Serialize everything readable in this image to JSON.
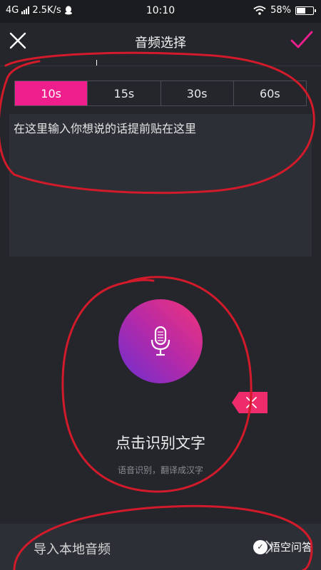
{
  "status_bar": {
    "network": "4G",
    "speed": "2.5K/s",
    "time": "10:10",
    "battery": "58%",
    "battery_level": 0.58,
    "icons": [
      "signal-icon",
      "qq-icon",
      "wifi-icon",
      "battery-icon"
    ]
  },
  "header": {
    "title": "音频选择",
    "close_icon": "close-icon",
    "confirm_icon": "checkmark-icon",
    "accent_color": "#ee1e8d"
  },
  "duration_tabs": [
    {
      "label": "10s",
      "selected": true
    },
    {
      "label": "15s",
      "selected": false
    },
    {
      "label": "30s",
      "selected": false
    },
    {
      "label": "60s",
      "selected": false
    }
  ],
  "text_input": {
    "value": "在这里输入你想说的话提前贴在这里"
  },
  "voice": {
    "mic_icon": "microphone-icon",
    "label": "点击识别文字",
    "sublabel": "语音识别，翻译成汉字",
    "side_tab_icon": "collapse-icon"
  },
  "import": {
    "label": "导入本地音频",
    "chevron_icon": "chevron-right-icon"
  },
  "watermark": {
    "text": "悟空问答"
  },
  "colors": {
    "background": "#24262c",
    "panel": "#2d2f36",
    "annotation": "#d11a2a"
  }
}
